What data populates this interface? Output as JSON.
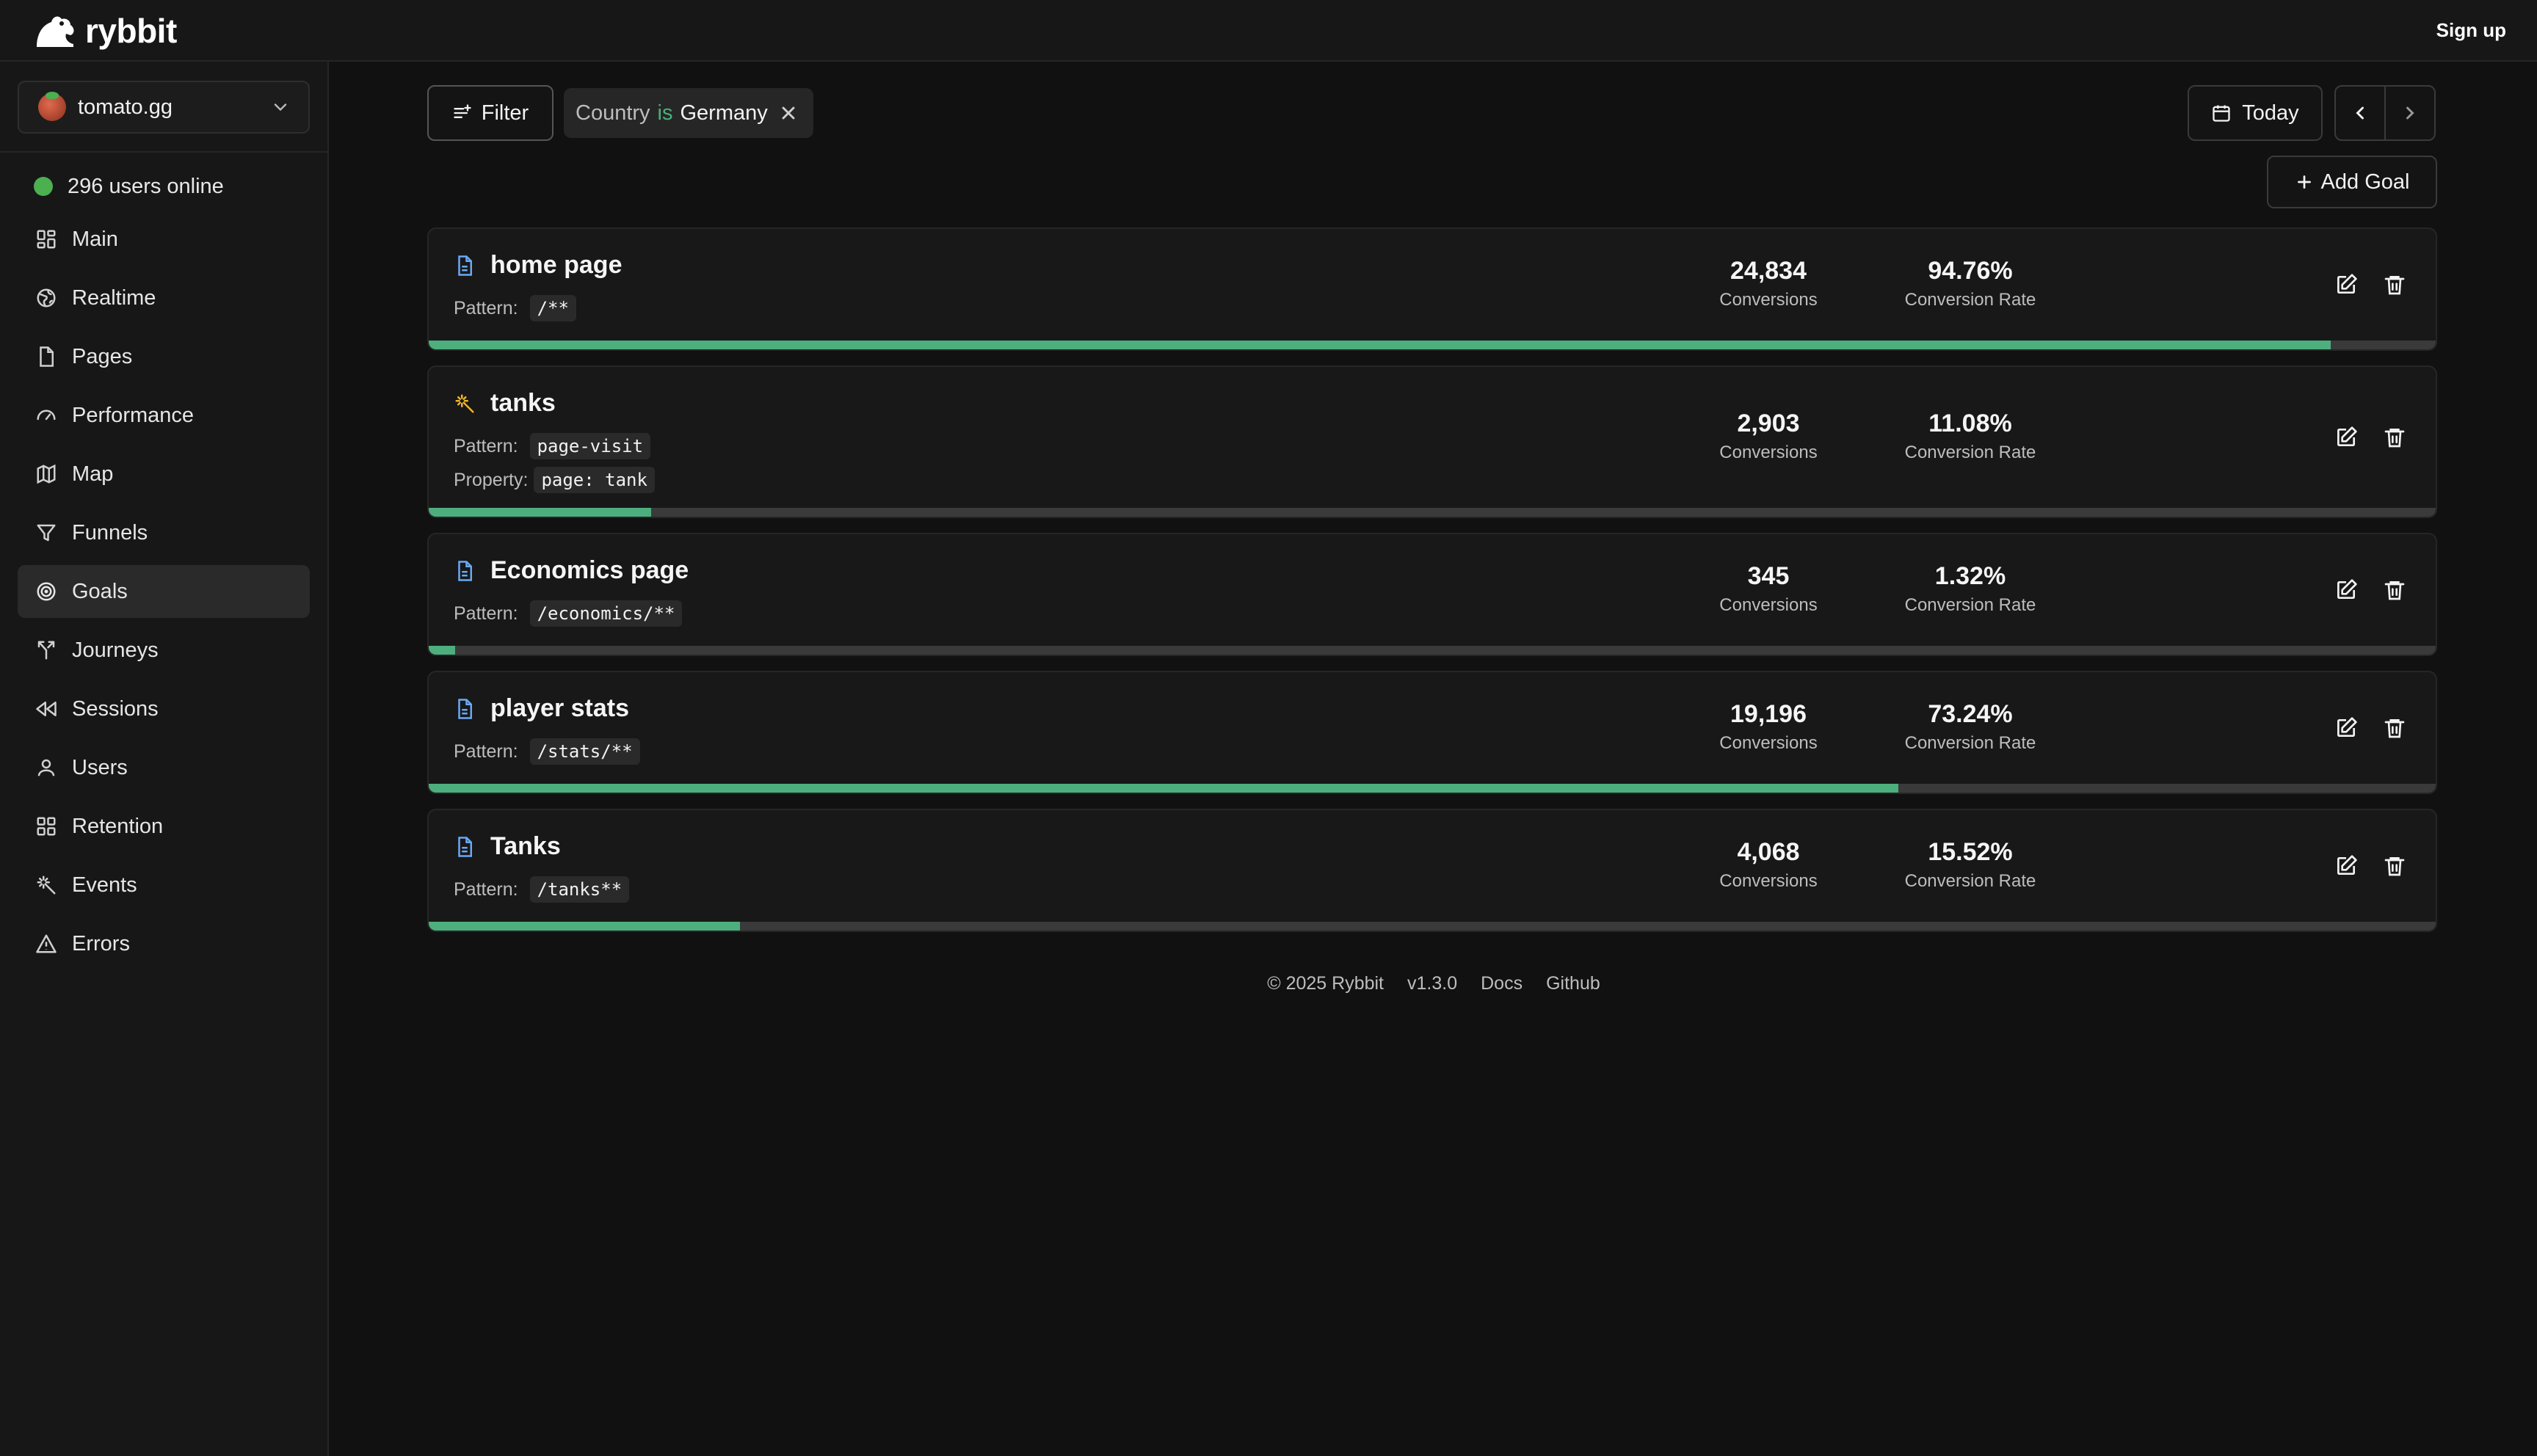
{
  "brand": {
    "name": "rybbit"
  },
  "header": {
    "signup_label": "Sign up"
  },
  "site": {
    "name": "tomato.gg"
  },
  "online": {
    "text": "296 users online",
    "color": "#4caf50"
  },
  "sidebar": {
    "items": [
      {
        "label": "Main",
        "icon": "grid-icon"
      },
      {
        "label": "Realtime",
        "icon": "globe-icon"
      },
      {
        "label": "Pages",
        "icon": "file-icon"
      },
      {
        "label": "Performance",
        "icon": "gauge-icon"
      },
      {
        "label": "Map",
        "icon": "map-icon"
      },
      {
        "label": "Funnels",
        "icon": "funnel-icon"
      },
      {
        "label": "Goals",
        "icon": "target-icon",
        "active": true
      },
      {
        "label": "Journeys",
        "icon": "split-icon"
      },
      {
        "label": "Sessions",
        "icon": "rewind-icon"
      },
      {
        "label": "Users",
        "icon": "user-icon"
      },
      {
        "label": "Retention",
        "icon": "grid-icon"
      },
      {
        "label": "Events",
        "icon": "sparkle-icon"
      },
      {
        "label": "Errors",
        "icon": "warning-icon"
      }
    ]
  },
  "toolbar": {
    "filter_label": "Filter",
    "chip": {
      "key": "Country",
      "op": "is",
      "value": "Germany"
    },
    "date_label": "Today",
    "add_goal_label": "Add Goal"
  },
  "goals": [
    {
      "name": "home page",
      "icon": "file-icon",
      "pattern_label": "Pattern:",
      "pattern": "/**",
      "conversions": "24,834",
      "conversions_label": "Conversions",
      "rate": "94.76%",
      "rate_label": "Conversion Rate",
      "progress": 0.9476
    },
    {
      "name": "tanks",
      "icon": "sparkle-icon",
      "pattern_label": "Pattern:",
      "pattern": "page-visit",
      "property_label": "Property:",
      "property": "page: tank",
      "conversions": "2,903",
      "conversions_label": "Conversions",
      "rate": "11.08%",
      "rate_label": "Conversion Rate",
      "progress": 0.1108
    },
    {
      "name": "Economics page",
      "icon": "file-icon",
      "pattern_label": "Pattern:",
      "pattern": "/economics/**",
      "conversions": "345",
      "conversions_label": "Conversions",
      "rate": "1.32%",
      "rate_label": "Conversion Rate",
      "progress": 0.0132
    },
    {
      "name": "player stats",
      "icon": "file-icon",
      "pattern_label": "Pattern:",
      "pattern": "/stats/**",
      "conversions": "19,196",
      "conversions_label": "Conversions",
      "rate": "73.24%",
      "rate_label": "Conversion Rate",
      "progress": 0.7324
    },
    {
      "name": "Tanks",
      "icon": "file-icon",
      "pattern_label": "Pattern:",
      "pattern": "/tanks**",
      "conversions": "4,068",
      "conversions_label": "Conversions",
      "rate": "15.52%",
      "rate_label": "Conversion Rate",
      "progress": 0.1552
    }
  ],
  "footer": {
    "copyright": "© 2025 Rybbit",
    "version": "v1.3.0",
    "docs": "Docs",
    "github": "Github"
  },
  "colors": {
    "accent": "#4caf7d",
    "background": "#111111",
    "panel": "#181818"
  }
}
